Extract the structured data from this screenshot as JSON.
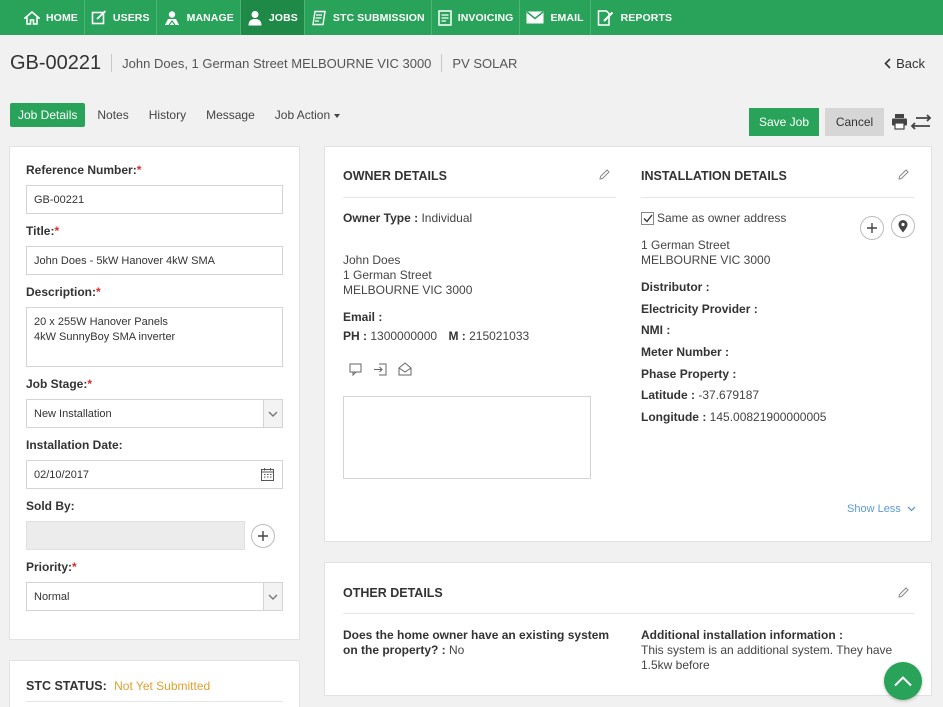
{
  "nav": {
    "items": [
      {
        "label": "HOME",
        "icon": "home-icon"
      },
      {
        "label": "USERS",
        "icon": "users-icon"
      },
      {
        "label": "MANAGE",
        "icon": "manage-icon"
      },
      {
        "label": "JOBS",
        "icon": "jobs-icon",
        "active": true
      },
      {
        "label": "STC SUBMISSION",
        "icon": "stc-submission-icon"
      },
      {
        "label": "INVOICING",
        "icon": "invoicing-icon"
      },
      {
        "label": "EMAIL",
        "icon": "email-icon"
      },
      {
        "label": "REPORTS",
        "icon": "reports-icon"
      }
    ]
  },
  "header": {
    "job_id": "GB-00221",
    "owner_address": "John Does, 1 German Street MELBOURNE VIC 3000",
    "job_type": "PV SOLAR",
    "back_label": "Back"
  },
  "tabs": [
    {
      "label": "Job Details",
      "active": true
    },
    {
      "label": "Notes"
    },
    {
      "label": "History"
    },
    {
      "label": "Message"
    },
    {
      "label": "Job Action",
      "dropdown": true
    }
  ],
  "actions": {
    "save_label": "Save Job",
    "cancel_label": "Cancel"
  },
  "form": {
    "reference_label": "Reference Number:",
    "reference_value": "GB-00221",
    "title_label": "Title:",
    "title_value": "John Does - 5kW Hanover 4kW SMA",
    "description_label": "Description:",
    "description_line1": "20 x 255W Hanover Panels",
    "description_line2": "4kW SunnyBoy SMA inverter",
    "job_stage_label": "Job Stage:",
    "job_stage_value": "New Installation",
    "install_date_label": "Installation Date:",
    "install_date_value": "02/10/2017",
    "sold_by_label": "Sold By:",
    "priority_label": "Priority:",
    "priority_value": "Normal",
    "required_mark": "*"
  },
  "stc": {
    "label": "STC STATUS:",
    "value": "Not Yet Submitted",
    "value_color": "#e0a030"
  },
  "owner": {
    "title": "OWNER DETAILS",
    "owner_type_label": "Owner Type :",
    "owner_type_value": "Individual",
    "name": "John Does",
    "street": "1 German Street",
    "city": "MELBOURNE VIC 3000",
    "email_label": "Email :",
    "phone_label": "PH :",
    "phone_value": "1300000000",
    "mobile_label": "M :",
    "mobile_value": "215021033"
  },
  "installation": {
    "title": "INSTALLATION DETAILS",
    "same_as_owner": "Same as owner address",
    "street": "1 German Street",
    "city": "MELBOURNE VIC 3000",
    "distributor_label": "Distributor :",
    "electricity_label": "Electricity Provider :",
    "nmi_label": "NMI :",
    "meter_label": "Meter Number :",
    "phase_label": "Phase Property :",
    "latitude_label": "Latitude :",
    "latitude_value": "-37.679187",
    "longitude_label": "Longitude :",
    "longitude_value": "145.00821900000005",
    "show_less": "Show Less"
  },
  "other": {
    "title": "OTHER DETAILS",
    "existing_q1": "Does the home owner have an existing system",
    "existing_q2": "on the property? :",
    "existing_value": "No",
    "additional_label": "Additional installation information :",
    "additional_line1": "This system is an additional system. They have",
    "additional_line2": "1.5kw before"
  },
  "colors": {
    "brand_green": "#2aa35a",
    "link_blue": "#5b9bd5",
    "required_red": "#e02b2b"
  }
}
